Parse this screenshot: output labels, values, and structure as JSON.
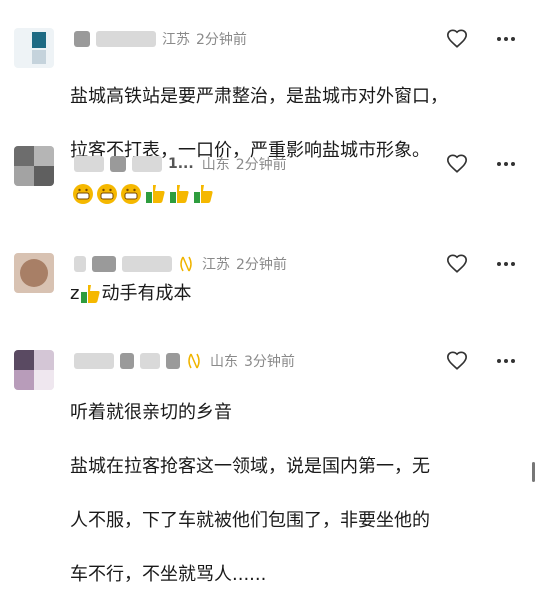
{
  "comments": [
    {
      "region": "江苏",
      "time": "2分钟前",
      "lines": [
        "盐城高铁站是要严肃整治，是盐城市对外窗口，",
        "拉客不打表，一口价，严重影响盐城市形象。"
      ]
    },
    {
      "name_tail": "1...",
      "region": "山东",
      "time": "2分钟前",
      "emojis": [
        "grin-emoji",
        "grin-emoji",
        "grin-emoji",
        "thumbs-up-emoji",
        "thumbs-up-emoji",
        "thumbs-up-emoji"
      ]
    },
    {
      "region": "江苏",
      "time": "2分钟前",
      "text_prefix": "z",
      "text_suffix": "动手有成本"
    },
    {
      "region": "山东",
      "time": "3分钟前",
      "lines": [
        "听着就很亲切的乡音",
        "盐城在拉客抢客这一领域，说是国内第一，无",
        "人不服，下了车就被他们包围了，非要坐他的",
        "车不行，不坐就骂人......"
      ]
    }
  ],
  "colors": {
    "meta": "#8a8a8a",
    "text": "#1a1a1a",
    "icon": "#333333",
    "badge": "#f0b400"
  }
}
